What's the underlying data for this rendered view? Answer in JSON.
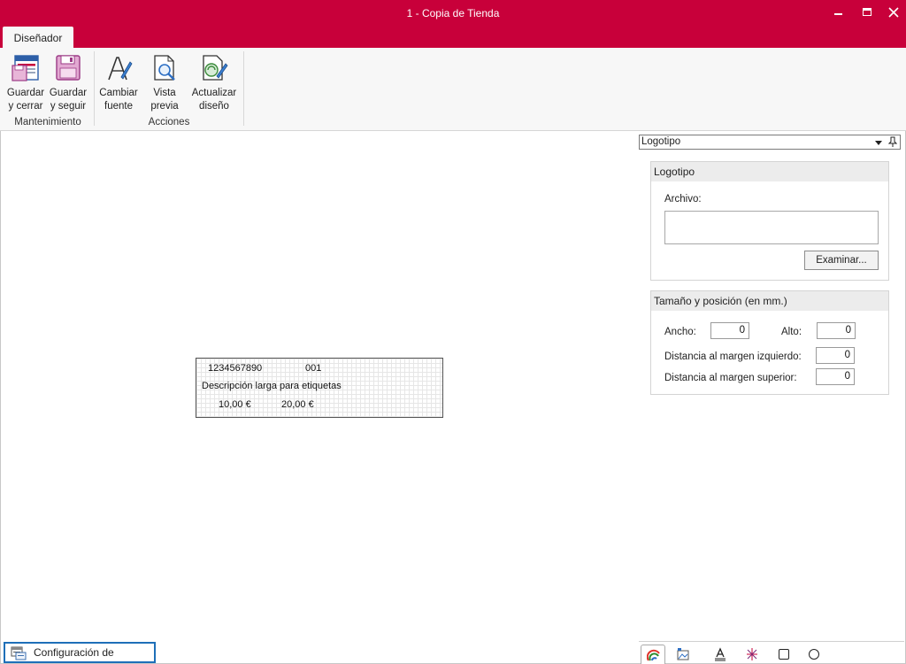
{
  "window": {
    "title": "1 - Copia de Tienda"
  },
  "ribbon": {
    "tab": "Diseñador",
    "buttons": {
      "guardar_cerrar": "Guardar\ny cerrar",
      "guardar_seguir": "Guardar\ny seguir",
      "cambiar_fuente": "Cambiar\nfuente",
      "vista_previa": "Vista\nprevia",
      "actualizar_diseno": "Actualizar\ndiseño"
    },
    "groups": {
      "mantenimiento": "Mantenimiento",
      "acciones": "Acciones"
    }
  },
  "label_preview": {
    "barcode": "1234567890",
    "code": "001",
    "description": "Descripción larga para etiquetas",
    "price1": "10,00  €",
    "price2": "20,00  €"
  },
  "properties": {
    "object_selector": "Logotipo",
    "logo_section": {
      "header": "Logotipo",
      "file_label": "Archivo:",
      "file_value": "",
      "browse_button": "Examinar..."
    },
    "size_section": {
      "header": "Tamaño y posición (en mm.)",
      "ancho_label": "Ancho:",
      "ancho_value": "0",
      "alto_label": "Alto:",
      "alto_value": "0",
      "margen_izq_label": "Distancia al margen izquierdo:",
      "margen_izq_value": "0",
      "margen_sup_label": "Distancia al margen superior:",
      "margen_sup_value": "0"
    }
  },
  "bottom": {
    "config_button": "Configuración de etiqueta",
    "tools": [
      "palette-icon",
      "image-icon",
      "text-icon",
      "barcode-icon",
      "rectangle-icon",
      "circle-icon"
    ]
  },
  "colors": {
    "brand": "#c8003a",
    "ribbon_bg": "#f7f7f7",
    "focus_border": "#1e6fb8"
  }
}
